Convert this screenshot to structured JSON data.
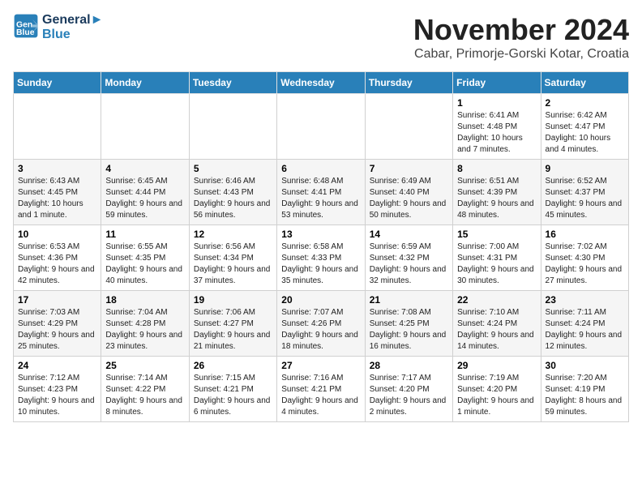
{
  "logo": {
    "line1": "General",
    "line2": "Blue"
  },
  "header": {
    "month": "November 2024",
    "location": "Cabar, Primorje-Gorski Kotar, Croatia"
  },
  "weekdays": [
    "Sunday",
    "Monday",
    "Tuesday",
    "Wednesday",
    "Thursday",
    "Friday",
    "Saturday"
  ],
  "weeks": [
    [
      {
        "day": "",
        "info": ""
      },
      {
        "day": "",
        "info": ""
      },
      {
        "day": "",
        "info": ""
      },
      {
        "day": "",
        "info": ""
      },
      {
        "day": "",
        "info": ""
      },
      {
        "day": "1",
        "info": "Sunrise: 6:41 AM\nSunset: 4:48 PM\nDaylight: 10 hours and 7 minutes."
      },
      {
        "day": "2",
        "info": "Sunrise: 6:42 AM\nSunset: 4:47 PM\nDaylight: 10 hours and 4 minutes."
      }
    ],
    [
      {
        "day": "3",
        "info": "Sunrise: 6:43 AM\nSunset: 4:45 PM\nDaylight: 10 hours and 1 minute."
      },
      {
        "day": "4",
        "info": "Sunrise: 6:45 AM\nSunset: 4:44 PM\nDaylight: 9 hours and 59 minutes."
      },
      {
        "day": "5",
        "info": "Sunrise: 6:46 AM\nSunset: 4:43 PM\nDaylight: 9 hours and 56 minutes."
      },
      {
        "day": "6",
        "info": "Sunrise: 6:48 AM\nSunset: 4:41 PM\nDaylight: 9 hours and 53 minutes."
      },
      {
        "day": "7",
        "info": "Sunrise: 6:49 AM\nSunset: 4:40 PM\nDaylight: 9 hours and 50 minutes."
      },
      {
        "day": "8",
        "info": "Sunrise: 6:51 AM\nSunset: 4:39 PM\nDaylight: 9 hours and 48 minutes."
      },
      {
        "day": "9",
        "info": "Sunrise: 6:52 AM\nSunset: 4:37 PM\nDaylight: 9 hours and 45 minutes."
      }
    ],
    [
      {
        "day": "10",
        "info": "Sunrise: 6:53 AM\nSunset: 4:36 PM\nDaylight: 9 hours and 42 minutes."
      },
      {
        "day": "11",
        "info": "Sunrise: 6:55 AM\nSunset: 4:35 PM\nDaylight: 9 hours and 40 minutes."
      },
      {
        "day": "12",
        "info": "Sunrise: 6:56 AM\nSunset: 4:34 PM\nDaylight: 9 hours and 37 minutes."
      },
      {
        "day": "13",
        "info": "Sunrise: 6:58 AM\nSunset: 4:33 PM\nDaylight: 9 hours and 35 minutes."
      },
      {
        "day": "14",
        "info": "Sunrise: 6:59 AM\nSunset: 4:32 PM\nDaylight: 9 hours and 32 minutes."
      },
      {
        "day": "15",
        "info": "Sunrise: 7:00 AM\nSunset: 4:31 PM\nDaylight: 9 hours and 30 minutes."
      },
      {
        "day": "16",
        "info": "Sunrise: 7:02 AM\nSunset: 4:30 PM\nDaylight: 9 hours and 27 minutes."
      }
    ],
    [
      {
        "day": "17",
        "info": "Sunrise: 7:03 AM\nSunset: 4:29 PM\nDaylight: 9 hours and 25 minutes."
      },
      {
        "day": "18",
        "info": "Sunrise: 7:04 AM\nSunset: 4:28 PM\nDaylight: 9 hours and 23 minutes."
      },
      {
        "day": "19",
        "info": "Sunrise: 7:06 AM\nSunset: 4:27 PM\nDaylight: 9 hours and 21 minutes."
      },
      {
        "day": "20",
        "info": "Sunrise: 7:07 AM\nSunset: 4:26 PM\nDaylight: 9 hours and 18 minutes."
      },
      {
        "day": "21",
        "info": "Sunrise: 7:08 AM\nSunset: 4:25 PM\nDaylight: 9 hours and 16 minutes."
      },
      {
        "day": "22",
        "info": "Sunrise: 7:10 AM\nSunset: 4:24 PM\nDaylight: 9 hours and 14 minutes."
      },
      {
        "day": "23",
        "info": "Sunrise: 7:11 AM\nSunset: 4:24 PM\nDaylight: 9 hours and 12 minutes."
      }
    ],
    [
      {
        "day": "24",
        "info": "Sunrise: 7:12 AM\nSunset: 4:23 PM\nDaylight: 9 hours and 10 minutes."
      },
      {
        "day": "25",
        "info": "Sunrise: 7:14 AM\nSunset: 4:22 PM\nDaylight: 9 hours and 8 minutes."
      },
      {
        "day": "26",
        "info": "Sunrise: 7:15 AM\nSunset: 4:21 PM\nDaylight: 9 hours and 6 minutes."
      },
      {
        "day": "27",
        "info": "Sunrise: 7:16 AM\nSunset: 4:21 PM\nDaylight: 9 hours and 4 minutes."
      },
      {
        "day": "28",
        "info": "Sunrise: 7:17 AM\nSunset: 4:20 PM\nDaylight: 9 hours and 2 minutes."
      },
      {
        "day": "29",
        "info": "Sunrise: 7:19 AM\nSunset: 4:20 PM\nDaylight: 9 hours and 1 minute."
      },
      {
        "day": "30",
        "info": "Sunrise: 7:20 AM\nSunset: 4:19 PM\nDaylight: 8 hours and 59 minutes."
      }
    ]
  ]
}
